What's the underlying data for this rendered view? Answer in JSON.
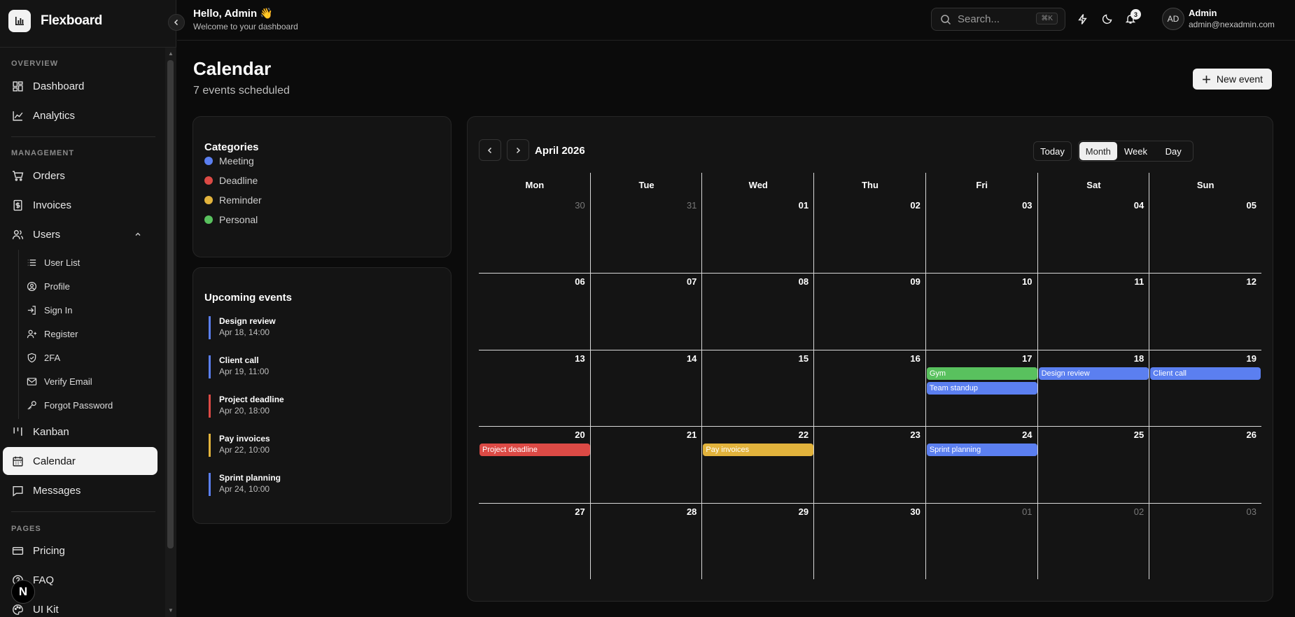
{
  "brand": {
    "name": "Flexboard"
  },
  "sidebar": {
    "sections": {
      "overview": "OVERVIEW",
      "management": "MANAGEMENT",
      "pages": "PAGES"
    },
    "items": {
      "dashboard": "Dashboard",
      "analytics": "Analytics",
      "orders": "Orders",
      "invoices": "Invoices",
      "users": "Users",
      "kanban": "Kanban",
      "calendar": "Calendar",
      "messages": "Messages",
      "pricing": "Pricing",
      "faq": "FAQ",
      "uikit": "UI Kit"
    },
    "sub_items": {
      "user_list": "User List",
      "profile": "Profile",
      "sign_in": "Sign In",
      "register": "Register",
      "twofa": "2FA",
      "verify_email": "Verify Email",
      "forgot_password": "Forgot Password"
    },
    "badge": "N",
    "active": "calendar"
  },
  "topbar": {
    "greeting": "Hello, Admin 👋",
    "subtitle": "Welcome to your dashboard",
    "search_placeholder": "Search...",
    "search_shortcut": "⌘K",
    "notifications_count": "3",
    "avatar_initials": "AD",
    "user_name": "Admin",
    "user_email": "admin@nexadmin.com"
  },
  "page": {
    "title": "Calendar",
    "subtitle": "7 events scheduled",
    "new_event_label": "New event"
  },
  "categories": {
    "title": "Categories",
    "items": [
      {
        "label": "Meeting",
        "color": "#5b7ff0"
      },
      {
        "label": "Deadline",
        "color": "#dc4a45"
      },
      {
        "label": "Reminder",
        "color": "#e2b33c"
      },
      {
        "label": "Personal",
        "color": "#59c15e"
      }
    ]
  },
  "upcoming": {
    "title": "Upcoming events",
    "items": [
      {
        "name": "Design review",
        "time": "Apr 18, 14:00",
        "color": "#5b7ff0"
      },
      {
        "name": "Client call",
        "time": "Apr 19, 11:00",
        "color": "#5b7ff0"
      },
      {
        "name": "Project deadline",
        "time": "Apr 20, 18:00",
        "color": "#dc4a45"
      },
      {
        "name": "Pay invoices",
        "time": "Apr 22, 10:00",
        "color": "#e2b33c"
      },
      {
        "name": "Sprint planning",
        "time": "Apr 24, 10:00",
        "color": "#5b7ff0"
      }
    ]
  },
  "calendar": {
    "month_label": "April 2026",
    "today_label": "Today",
    "views": [
      "Month",
      "Week",
      "Day"
    ],
    "active_view": "Month",
    "weekdays": [
      "Mon",
      "Tue",
      "Wed",
      "Thu",
      "Fri",
      "Sat",
      "Sun"
    ],
    "weeks": [
      [
        {
          "d": "30",
          "m": true
        },
        {
          "d": "31",
          "m": true
        },
        {
          "d": "01"
        },
        {
          "d": "02"
        },
        {
          "d": "03"
        },
        {
          "d": "04"
        },
        {
          "d": "05"
        }
      ],
      [
        {
          "d": "06"
        },
        {
          "d": "07"
        },
        {
          "d": "08"
        },
        {
          "d": "09"
        },
        {
          "d": "10"
        },
        {
          "d": "11"
        },
        {
          "d": "12"
        }
      ],
      [
        {
          "d": "13"
        },
        {
          "d": "14"
        },
        {
          "d": "15"
        },
        {
          "d": "16"
        },
        {
          "d": "17"
        },
        {
          "d": "18"
        },
        {
          "d": "19"
        }
      ],
      [
        {
          "d": "20"
        },
        {
          "d": "21"
        },
        {
          "d": "22"
        },
        {
          "d": "23"
        },
        {
          "d": "24"
        },
        {
          "d": "25"
        },
        {
          "d": "26"
        }
      ],
      [
        {
          "d": "27"
        },
        {
          "d": "28"
        },
        {
          "d": "29"
        },
        {
          "d": "30"
        },
        {
          "d": "01",
          "m": true
        },
        {
          "d": "02",
          "m": true
        },
        {
          "d": "03",
          "m": true
        }
      ]
    ],
    "events": [
      {
        "title": "Gym",
        "week": 2,
        "day": 4,
        "slot": 0,
        "color": "#59c15e"
      },
      {
        "title": "Team standup",
        "week": 2,
        "day": 4,
        "slot": 1,
        "color": "#5b7ff0"
      },
      {
        "title": "Design review",
        "week": 2,
        "day": 5,
        "slot": 0,
        "color": "#5b7ff0"
      },
      {
        "title": "Client call",
        "week": 2,
        "day": 6,
        "slot": 0,
        "color": "#5b7ff0"
      },
      {
        "title": "Project deadline",
        "week": 3,
        "day": 0,
        "slot": 0,
        "color": "#dc4a45"
      },
      {
        "title": "Pay invoices",
        "week": 3,
        "day": 2,
        "slot": 0,
        "color": "#e2b33c"
      },
      {
        "title": "Sprint planning",
        "week": 3,
        "day": 4,
        "slot": 0,
        "color": "#5b7ff0"
      }
    ]
  }
}
